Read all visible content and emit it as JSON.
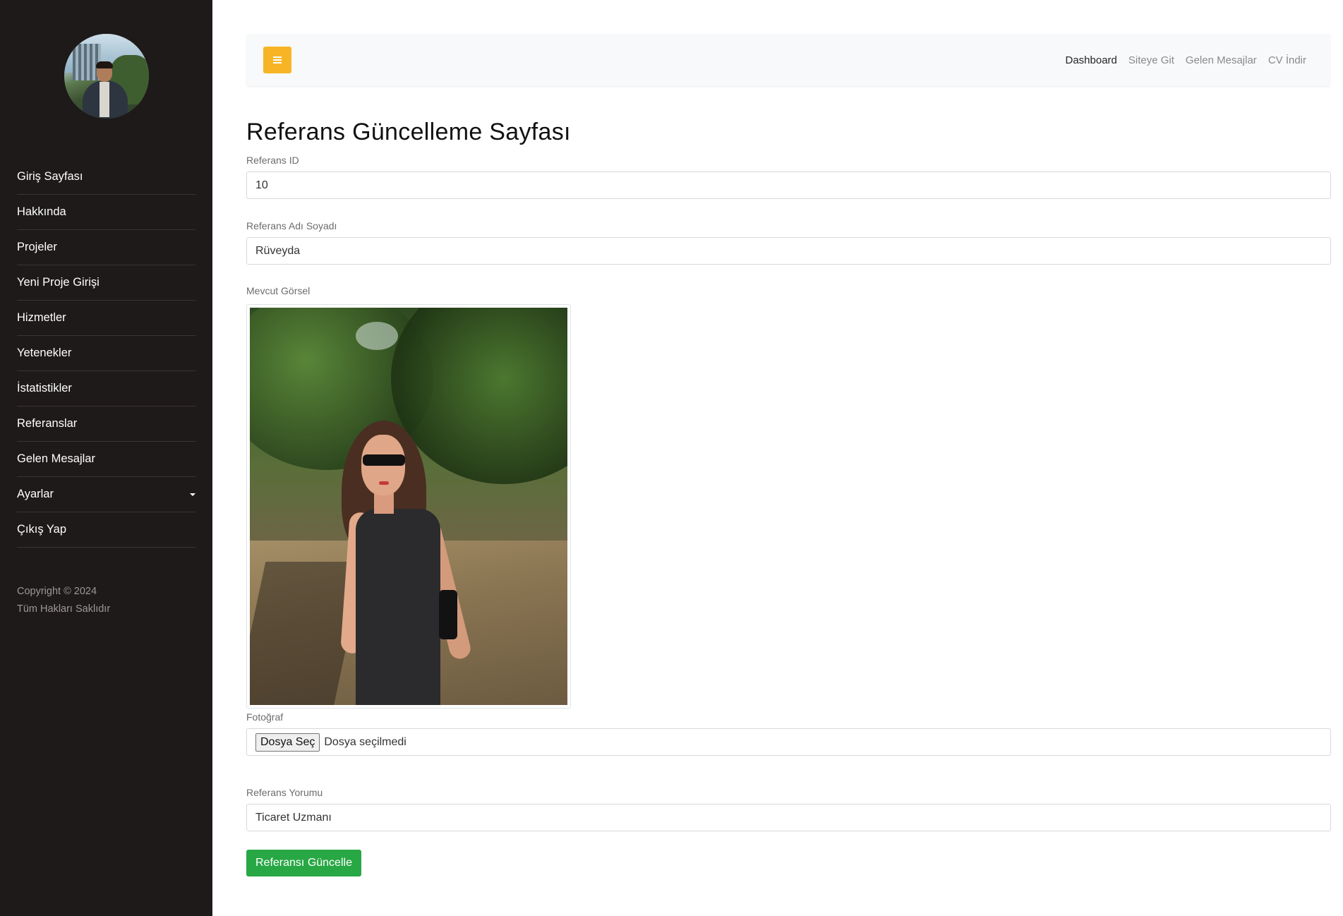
{
  "sidebar": {
    "avatar_icon": "user-avatar",
    "items": [
      {
        "label": "Giriş Sayfası"
      },
      {
        "label": "Hakkında"
      },
      {
        "label": "Projeler"
      },
      {
        "label": "Yeni Proje Girişi"
      },
      {
        "label": "Hizmetler"
      },
      {
        "label": "Yetenekler"
      },
      {
        "label": "İstatistikler"
      },
      {
        "label": "Referanslar"
      },
      {
        "label": "Gelen Mesajlar"
      },
      {
        "label": "Ayarlar"
      },
      {
        "label": "Çıkış Yap"
      }
    ],
    "footer": {
      "copyright": "Copyright © 2024",
      "rights": "Tüm Hakları Saklıdır"
    }
  },
  "topbar": {
    "toggle_icon": "menu-icon",
    "toggle_color": "#f7b526",
    "links": [
      {
        "label": "Dashboard"
      },
      {
        "label": "Siteye Git"
      },
      {
        "label": "Gelen Mesajlar"
      },
      {
        "label": "CV İndir"
      }
    ]
  },
  "page": {
    "title": "Referans Güncelleme Sayfası"
  },
  "form": {
    "id_label": "Referans ID",
    "id_value": "10",
    "name_label": "Referans Adı Soyadı",
    "name_value": "Rüveyda",
    "current_image_label": "Mevcut Görsel",
    "photo_label": "Fotoğraf",
    "file_button": "Dosya Seç",
    "file_status": "Dosya seçilmedi",
    "comment_label": "Referans Yorumu",
    "comment_value": "Ticaret Uzmanı",
    "submit_label": "Referansı Güncelle",
    "submit_color": "#28a745"
  }
}
